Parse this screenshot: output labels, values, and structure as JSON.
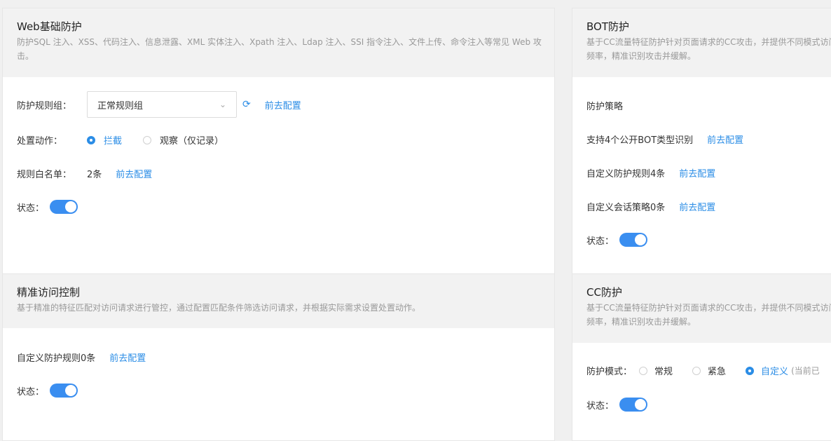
{
  "web": {
    "title": "Web基础防护",
    "desc": "防护SQL 注入、XSS、代码注入、信息泄露、XML 实体注入、Xpath 注入、Ldap 注入、SSI 指令注入、文件上传、命令注入等常见 Web 攻击。",
    "rule_group_label": "防护规则组：",
    "rule_group_value": "正常规则组",
    "config_link": "前去配置",
    "action_label": "处置动作：",
    "action_options": [
      "拦截",
      "观察（仅记录）"
    ],
    "whitelist_label": "规则白名单：",
    "whitelist_value": "2条",
    "status_label": "状态："
  },
  "bot": {
    "title": "BOT防护",
    "desc": "基于CC流量特征防护针对页面请求的CC攻击，并提供不同模式访问频率，精准识别攻击并缓解。",
    "strategy_label": "防护策略",
    "item1": "支持4个公开BOT类型识别",
    "item2": "自定义防护规则4条",
    "item3": "自定义会话策略0条",
    "config_link": "前去配置",
    "status_label": "状态："
  },
  "access": {
    "title": "精准访问控制",
    "desc": "基于精准的特征匹配对访问请求进行管控，通过配置匹配条件筛选访问请求，并根据实际需求设置处置动作。",
    "rule_text": "自定义防护规则0条",
    "config_link": "前去配置",
    "status_label": "状态："
  },
  "cc": {
    "title": "CC防护",
    "desc": "基于CC流量特征防护针对页面请求的CC攻击，并提供不同模式访问频率，精准识别攻击并缓解。",
    "mode_label": "防护模式：",
    "modes": [
      "常规",
      "紧急",
      "自定义"
    ],
    "mode_note": "(当前已",
    "status_label": "状态："
  },
  "colors": {
    "accent": "#2b8de6",
    "toggle_on": "#3a8ef0",
    "head_bg": "#f2f2f2"
  }
}
